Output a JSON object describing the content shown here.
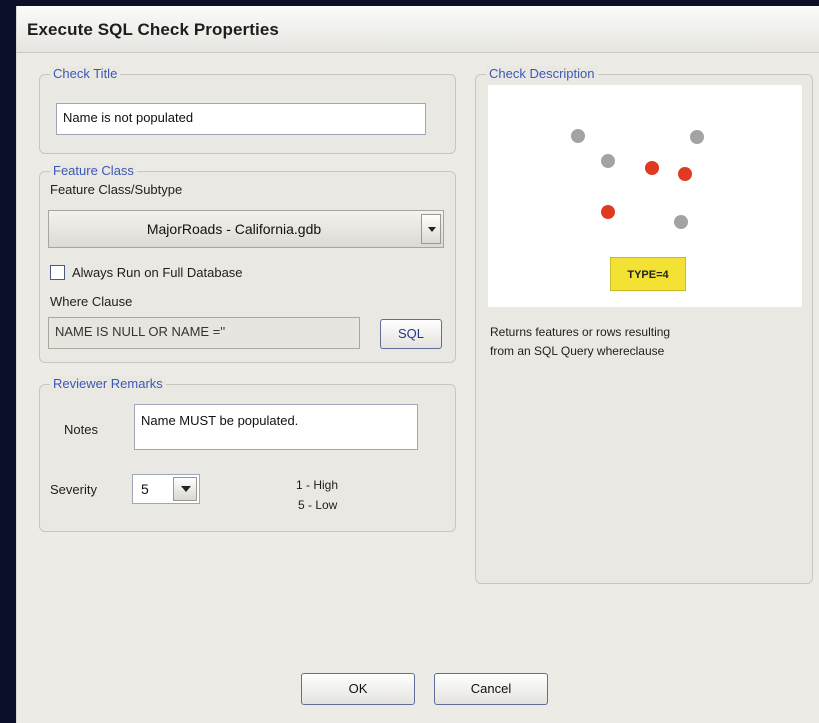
{
  "window": {
    "title": "Execute SQL Check Properties"
  },
  "check_title": {
    "legend": "Check Title",
    "value": "Name is not populated"
  },
  "feature_class": {
    "legend": "Feature Class",
    "subtype_label": "Feature Class/Subtype",
    "selected": "MajorRoads - California.gdb",
    "always_run_label": "Always Run on Full Database",
    "always_run_checked": false,
    "where_clause_label": "Where Clause",
    "where_clause_value": "NAME IS NULL OR NAME =''",
    "sql_button": "SQL"
  },
  "reviewer_remarks": {
    "legend": "Reviewer Remarks",
    "notes_label": "Notes",
    "notes_value": "Name MUST be populated.",
    "severity_label": "Severity",
    "severity_value": "5",
    "severity_high": "1 - High",
    "severity_low": "5 - Low"
  },
  "check_description": {
    "legend": "Check Description",
    "badge": "TYPE=4",
    "text_line1": "Returns features or rows resulting",
    "text_line2": "from an SQL Query whereclause"
  },
  "buttons": {
    "ok": "OK",
    "cancel": "Cancel"
  },
  "colors": {
    "legend": "#3a58b8",
    "badge": "#f3e233",
    "red_dot": "#e03a22",
    "grey_dot": "#a3a3a3"
  }
}
